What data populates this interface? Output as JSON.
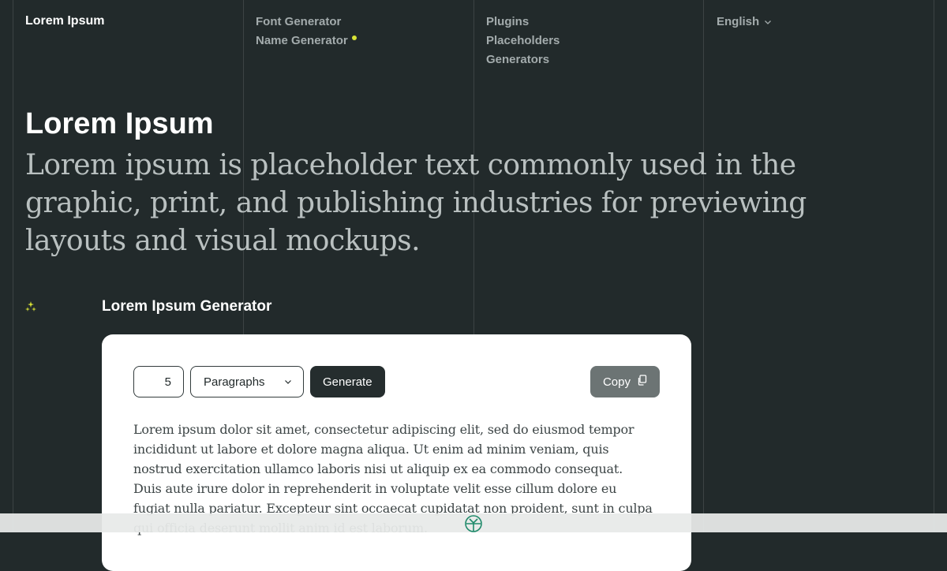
{
  "nav": {
    "brand": "Lorem Ipsum",
    "col1": [
      "Font Generator",
      "Name Generator"
    ],
    "col2": [
      "Plugins",
      "Placeholders",
      "Generators"
    ],
    "language": "English"
  },
  "hero": {
    "title": "Lorem Ipsum",
    "subtitle": "Lorem ipsum is placeholder text commonly used in the graphic, print, and publishing industries for previewing layouts and visual mockups."
  },
  "generator": {
    "heading": "Lorem Ipsum Generator",
    "count_value": "5",
    "unit_selected": "Paragraphs",
    "generate_label": "Generate",
    "copy_label": "Copy",
    "output_text": "Lorem ipsum dolor sit amet, consectetur adipiscing elit, sed do eiusmod tempor incididunt ut labore et dolore magna aliqua. Ut enim ad minim veniam, quis nostrud exercitation ullamco laboris nisi ut aliquip ex ea commodo consequat. Duis aute irure dolor in reprehenderit in voluptate velit esse cillum dolore eu fugiat nulla pariatur. Excepteur sint occaecat cupidatat non proident, sunt in culpa qui officia deserunt mollit anim id est laborum."
  },
  "icons": {
    "new_dot": "new-indicator-dot",
    "language_chevron": "chevron-down-icon",
    "select_chevron": "chevron-down-icon",
    "copy": "copy-icon",
    "sparkle": "sparkle-icon",
    "bottom_logo": "logo-icon"
  },
  "colors": {
    "background": "#222a2b",
    "accent": "#d9e336",
    "nav_text": "#a3abac",
    "subtitle_text": "#b9c0c0",
    "card": "#ffffff",
    "generate_button": "#252d2e",
    "copy_button": "#6c7474",
    "logo": "#1f8a6a"
  }
}
